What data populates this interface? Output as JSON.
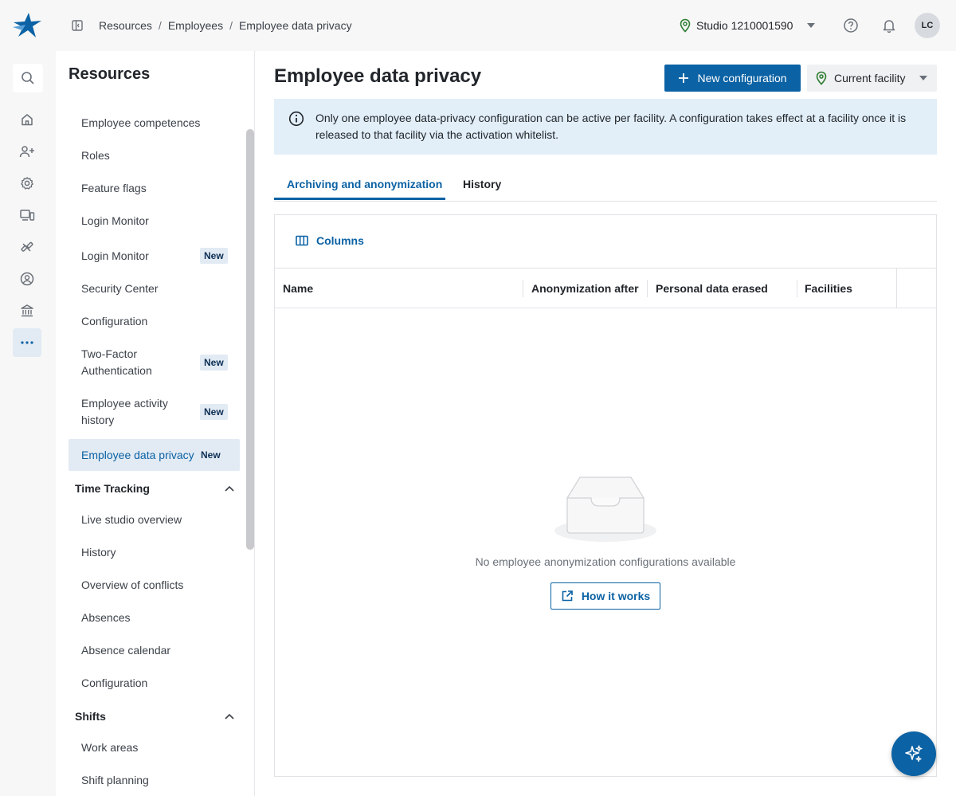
{
  "breadcrumb": [
    "Resources",
    "Employees",
    "Employee data privacy"
  ],
  "studio": {
    "name": "Studio 1210001590"
  },
  "user": {
    "initials": "LC"
  },
  "colors": {
    "accent": "#0b62a4",
    "banner": "#e2eff9",
    "badge": "#e2eaf3"
  },
  "rail": {
    "icons": [
      "search-icon",
      "home-icon",
      "add-user-icon",
      "gear-icon",
      "devices-icon",
      "tools-icon",
      "profile-icon",
      "bank-icon",
      "more-icon"
    ]
  },
  "sidebar": {
    "title": "Resources",
    "items": [
      {
        "label": "Employee competences"
      },
      {
        "label": "Roles"
      },
      {
        "label": "Feature flags"
      },
      {
        "label": "Login Monitor"
      },
      {
        "label": "Login Monitor",
        "badge": "New"
      },
      {
        "label": "Security Center"
      },
      {
        "label": "Configuration"
      },
      {
        "label": "Two-Factor Authentication",
        "badge": "New"
      },
      {
        "label": "Employee activity history",
        "badge": "New"
      },
      {
        "label": "Employee data privacy",
        "badge": "New"
      }
    ],
    "sections": [
      {
        "title": "Time Tracking",
        "items": [
          "Live studio overview",
          "History",
          "Overview of conflicts",
          "Absences",
          "Absence calendar",
          "Configuration"
        ]
      },
      {
        "title": "Shifts",
        "items": [
          "Work areas",
          "Shift planning"
        ]
      }
    ]
  },
  "main": {
    "title": "Employee data privacy",
    "new_config_label": "New configuration",
    "facility_label": "Current facility",
    "info_text": "Only one employee data-privacy configuration can be active per facility. A configuration takes effect at a facility once it is released to that facility via the activation whitelist.",
    "tabs": [
      {
        "label": "Archiving and anonymization"
      },
      {
        "label": "History"
      }
    ],
    "columns_label": "Columns",
    "table_headers": [
      "Name",
      "Anonymization after",
      "Personal data erased",
      "Facilities"
    ],
    "empty_text": "No employee anonymization configurations available",
    "how_label": "How it works"
  }
}
